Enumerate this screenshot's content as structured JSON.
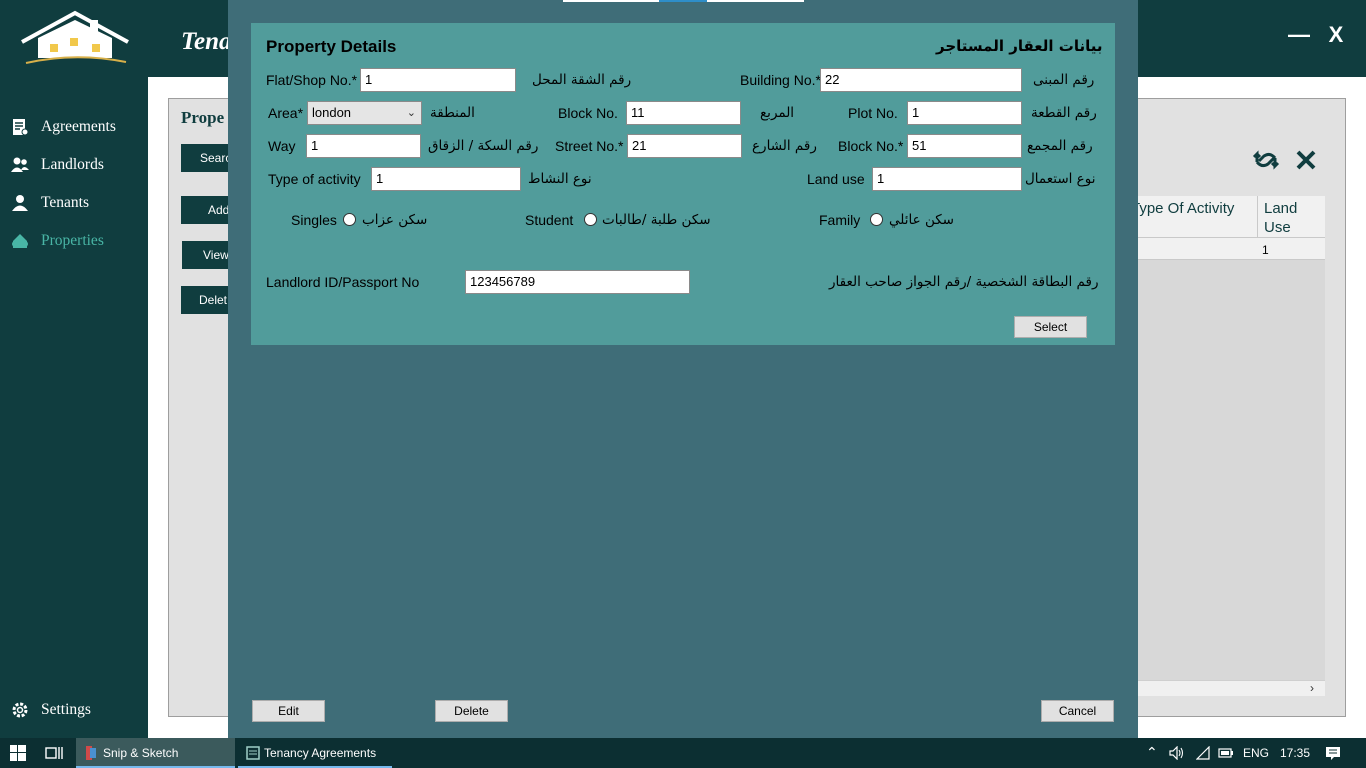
{
  "header": {
    "app_title": "Tena",
    "minimize": "—",
    "close": "X"
  },
  "sidebar": {
    "items": [
      {
        "label": "Agreements",
        "icon": "agreement-icon"
      },
      {
        "label": "Landlords",
        "icon": "landlords-icon"
      },
      {
        "label": "Tenants",
        "icon": "tenant-icon"
      },
      {
        "label": "Properties",
        "icon": "properties-icon",
        "active": true
      }
    ],
    "settings": "Settings"
  },
  "background": {
    "title": "Prope",
    "buttons": [
      "Searc",
      "Add",
      "View",
      "Delet"
    ],
    "table": {
      "columns": [
        "Type Of Activity",
        "Land Use"
      ],
      "cell": "1"
    },
    "scroll_arrow": "›"
  },
  "modal": {
    "title_en": "Property Details",
    "title_ar": "بيانات العقار المستاجر",
    "fields": {
      "flat_label": "Flat/Shop No.*",
      "flat_value": "1",
      "flat_ar": "رقم الشقة المحل",
      "building_label": "Building No.*",
      "building_value": "22",
      "building_ar": "رقم المبنى",
      "area_label": "Area*",
      "area_value": "london",
      "area_ar": "المنطقة",
      "blockno_label": "Block No.",
      "blockno_value": "11",
      "blockno_ar": "المربع",
      "plot_label": "Plot No.",
      "plot_value": "1",
      "plot_ar": "رقم القطعة",
      "way_label": "Way",
      "way_value": "1",
      "way_ar": "رقم السكة / الزقاق",
      "street_label": "Street No.*",
      "street_value": "21",
      "street_ar": "رقم الشارع",
      "complex_label": "Block No.*",
      "complex_value": "51",
      "complex_ar": "رقم المجمع",
      "activity_label": "Type of activity",
      "activity_value": "1",
      "activity_ar": "نوع النشاط",
      "landuse_label": "Land use",
      "landuse_value": "1",
      "landuse_ar": "نوع استعمال"
    },
    "radios": {
      "singles": "Singles",
      "singles_ar": "سكن عزاب",
      "student": "Student",
      "student_ar": "سكن طلبة /طالبات",
      "family": "Family",
      "family_ar": "سكن عائلي"
    },
    "landlord": {
      "label": "Landlord ID/Passport No",
      "value": "123456789",
      "ar": "رقم البطاقة الشخصية /رقم الجواز  صاحب العقار"
    },
    "buttons": {
      "select": "Select",
      "edit": "Edit",
      "delete": "Delete",
      "cancel": "Cancel"
    }
  },
  "taskbar": {
    "apps": [
      "Snip & Sketch",
      "Tenancy Agreements"
    ],
    "lang": "ENG",
    "time": "17:35"
  }
}
